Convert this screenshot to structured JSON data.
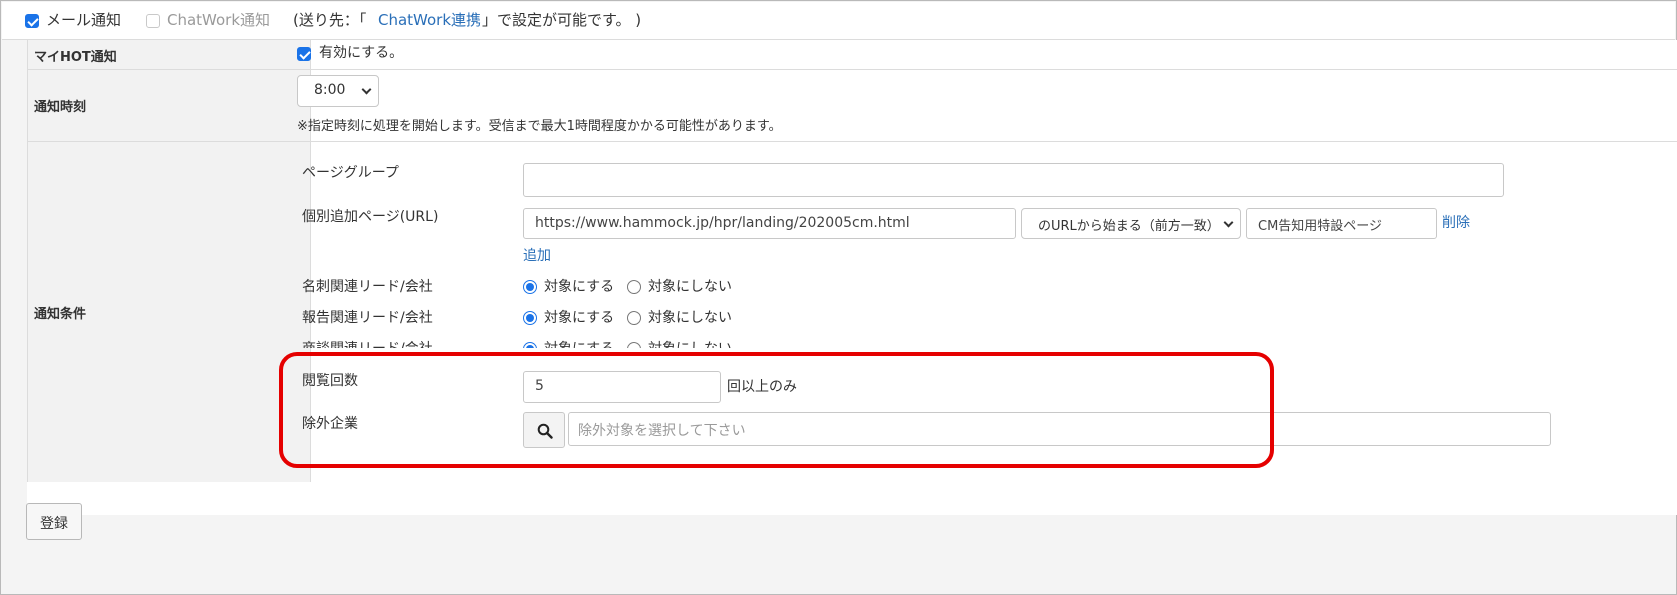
{
  "notify_channels": {
    "mail_label": "メール通知",
    "mail_checked": true,
    "chatwork_label": "ChatWork通知",
    "chatwork_checked": false,
    "note_prefix": "(送り先：「",
    "note_link": "ChatWork連携",
    "note_suffix": "」で設定が可能です。 )"
  },
  "myhot": {
    "label": "マイHOT通知",
    "checkbox_label": "有効にする。",
    "checked": true
  },
  "time": {
    "label": "通知時刻",
    "selected": "8:00",
    "note": "※指定時刻に処理を開始します。受信まで最大1時間程度かかる可能性があります。"
  },
  "conditions": {
    "label": "通知条件",
    "page_group_label": "ページグループ",
    "page_group_value": "",
    "url_label": "個別追加ページ(URL)",
    "url_value": "https://www.hammock.jp/hpr/landing/202005cm.html",
    "match_selected": "のURLから始まる（前方一致）",
    "url_name_value": "CM告知用特設ページ",
    "delete_label": "削除",
    "add_label": "追加",
    "lead_rows": [
      {
        "label": "名刺関連リード/会社",
        "on_label": "対象にする",
        "off_label": "対象にしない",
        "selected": "on"
      },
      {
        "label": "報告関連リード/会社",
        "on_label": "対象にする",
        "off_label": "対象にしない",
        "selected": "on"
      },
      {
        "label": "商談関連リード/会社",
        "on_label": "対象にする",
        "off_label": "対象にしない",
        "selected": "on"
      }
    ],
    "view_count_label": "閲覧回数",
    "view_count_value": "5",
    "view_count_suffix": "回以上のみ",
    "exclude_label": "除外企業",
    "exclude_placeholder": "除外対象を選択して下さい"
  },
  "submit_label": "登録",
  "colors": {
    "accent": "#1a73e8",
    "link": "#2a6fb8",
    "highlight": "#e50000"
  }
}
